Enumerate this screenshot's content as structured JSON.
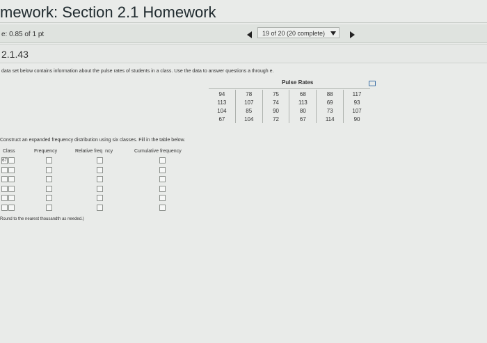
{
  "header": {
    "title": "mework: Section 2.1 Homework"
  },
  "status": {
    "score": "e: 0.85 of 1 pt",
    "question_selector": "19 of 20 (20 complete)"
  },
  "question": {
    "number": "2.1.43",
    "prompt": "data set below contains information about the pulse rates of students in a class. Use the data to answer questions a through e."
  },
  "pulse_table": {
    "title": "Pulse Rates",
    "rows": [
      [
        "94",
        "78",
        "75",
        "68",
        "88",
        "117"
      ],
      [
        "113",
        "107",
        "74",
        "113",
        "69",
        "93"
      ],
      [
        "104",
        "85",
        "90",
        "80",
        "73",
        "107"
      ],
      [
        "67",
        "104",
        "72",
        "67",
        "114",
        "90"
      ]
    ]
  },
  "part": {
    "instruction": "Construct an expanded frequency distribution using six classes. Fill in the table below.",
    "columns": [
      "Class",
      "Frequency",
      "Relative freq  ncy",
      "Cumulative frequency"
    ],
    "first_class_value": "67",
    "footnote": "Round to the nearest thousandth as needed.)"
  }
}
